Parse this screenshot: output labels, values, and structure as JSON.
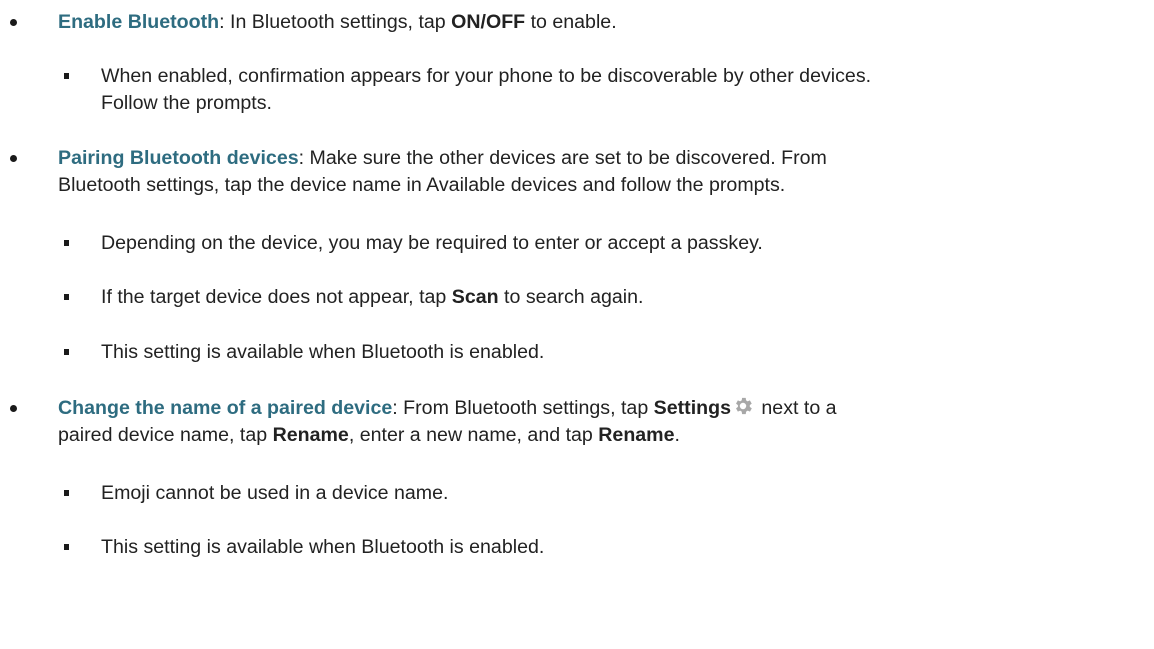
{
  "items": [
    {
      "title": "Enable Bluetooth",
      "sep": ":",
      "t1": " In Bluetooth settings, tap ",
      "b1": "ON/OFF",
      "t2": " to enable.",
      "sub": [
        {
          "line1": "When enabled, confirmation appears for your phone to be discoverable by other devices.",
          "line2": "Follow the prompts."
        }
      ]
    },
    {
      "title": "Pairing Bluetooth devices",
      "sep": ":",
      "t1": " Make sure the other devices are set to be discovered. From",
      "line2": "Bluetooth settings, tap the device name in Available devices and follow the prompts.",
      "sub": [
        {
          "text": "Depending on the device, you may be required to enter or accept a passkey."
        },
        {
          "t1": "If the target device does not appear, tap ",
          "b1": "Scan",
          "t2": " to search again."
        },
        {
          "text": "This setting is available when Bluetooth is enabled."
        }
      ]
    },
    {
      "title": "Change the name of a paired device",
      "sep": ":",
      "t1": " From Bluetooth settings, tap ",
      "b1": "Settings",
      "icon": "gear-icon",
      "t2": " next to a",
      "l2a": "paired device name, tap ",
      "l2b": "Rename",
      "l2c": ", enter a new name, and tap ",
      "l2d": "Rename",
      "l2e": ".",
      "sub": [
        {
          "text": "Emoji cannot be used in a device name."
        },
        {
          "text": "This setting is available when Bluetooth is enabled."
        }
      ]
    }
  ],
  "colors": {
    "title": "#2e6c80",
    "text": "#222222",
    "icon": "#a8a8a8"
  }
}
